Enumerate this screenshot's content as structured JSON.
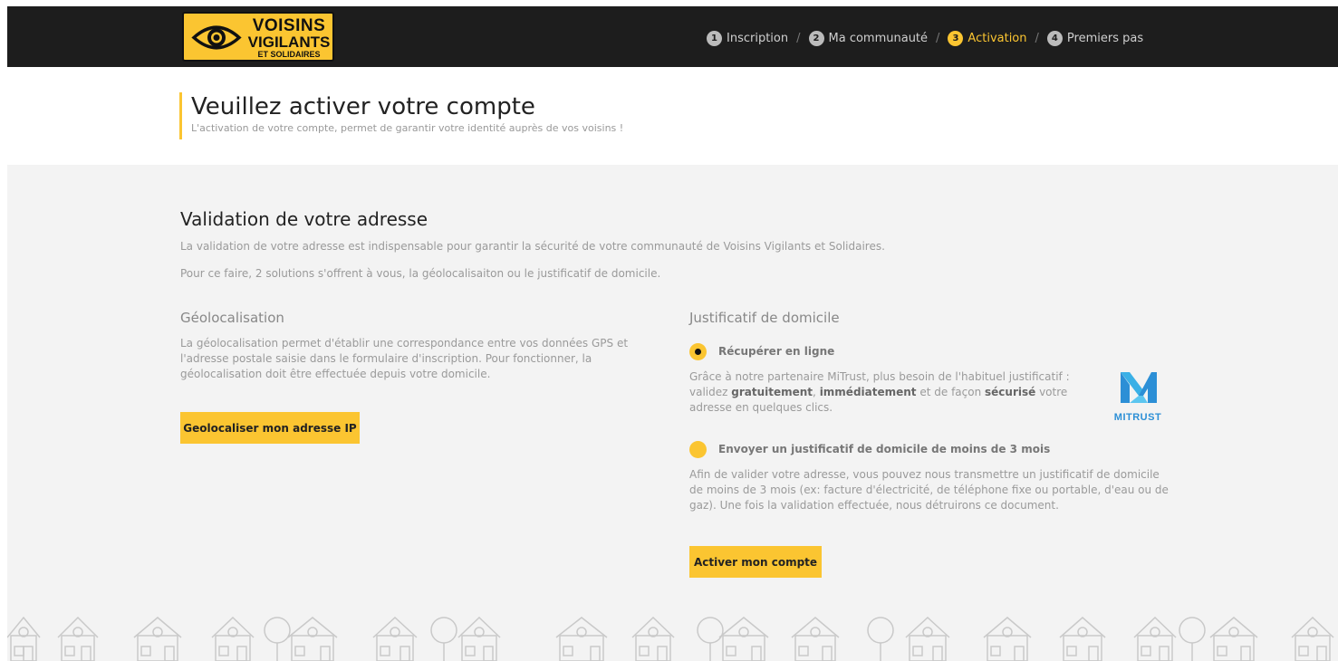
{
  "header": {
    "logo": {
      "line1": "VOISINS",
      "line2": "VIGILANTS",
      "line3": "ET SOLIDAIRES",
      "icon": "eye-icon"
    },
    "steps": [
      {
        "num": "1",
        "label": "Inscription",
        "active": false
      },
      {
        "num": "2",
        "label": "Ma communauté",
        "active": false
      },
      {
        "num": "3",
        "label": "Activation",
        "active": true
      },
      {
        "num": "4",
        "label": "Premiers pas",
        "active": false
      }
    ],
    "separator": "/"
  },
  "page": {
    "title": "Veuillez activer votre compte",
    "subtitle": "L'activation de votre compte, permet de garantir votre identité auprès de vos voisins !"
  },
  "validation": {
    "heading": "Validation de votre adresse",
    "intro1": "La validation de votre adresse est indispensable pour garantir la sécurité de votre communauté de Voisins Vigilants et Solidaires.",
    "intro2": "Pour ce faire, 2 solutions s'offrent à vous, la géolocalisaiton ou le justificatif de domicile."
  },
  "geoloc": {
    "heading": "Géolocalisation",
    "text": "La géolocalisation permet d'établir une correspondance entre vos données GPS et l'adresse postale saisie dans le formulaire d'inscription. Pour fonctionner, la géolocalisation doit être effectuée depuis votre domicile.",
    "button": "Geolocaliser mon adresse IP"
  },
  "justificatif": {
    "heading": "Justificatif de domicile",
    "option1": {
      "label": "Récupérer en ligne",
      "checked": true,
      "text_a": "Grâce à notre partenaire MiTrust, plus besoin de l'habituel justificatif : validez ",
      "bold1": "gratuitement",
      "sep": ", ",
      "bold2": "immédiatement",
      "text_b": " et de façon ",
      "bold3": "sécurisé",
      "text_c": " votre adresse en quelques clics."
    },
    "partner_logo": "MITRUST",
    "option2": {
      "label": "Envoyer un justificatif de domicile de moins de 3 mois",
      "checked": false,
      "text": "Afin de valider votre adresse, vous pouvez nous transmettre un justificatif de domicile de moins de 3 mois (ex: facture d'électricité, de téléphone fixe ou portable, d'eau ou de gaz). Une fois la validation effectuée, nous détruirons ce document."
    },
    "button": "Activer mon compte"
  },
  "colors": {
    "accent": "#fbc531",
    "header_bg": "#1d1d1d",
    "section_bg": "#f3f3f3",
    "partner_blue": "#2c8fd6"
  }
}
